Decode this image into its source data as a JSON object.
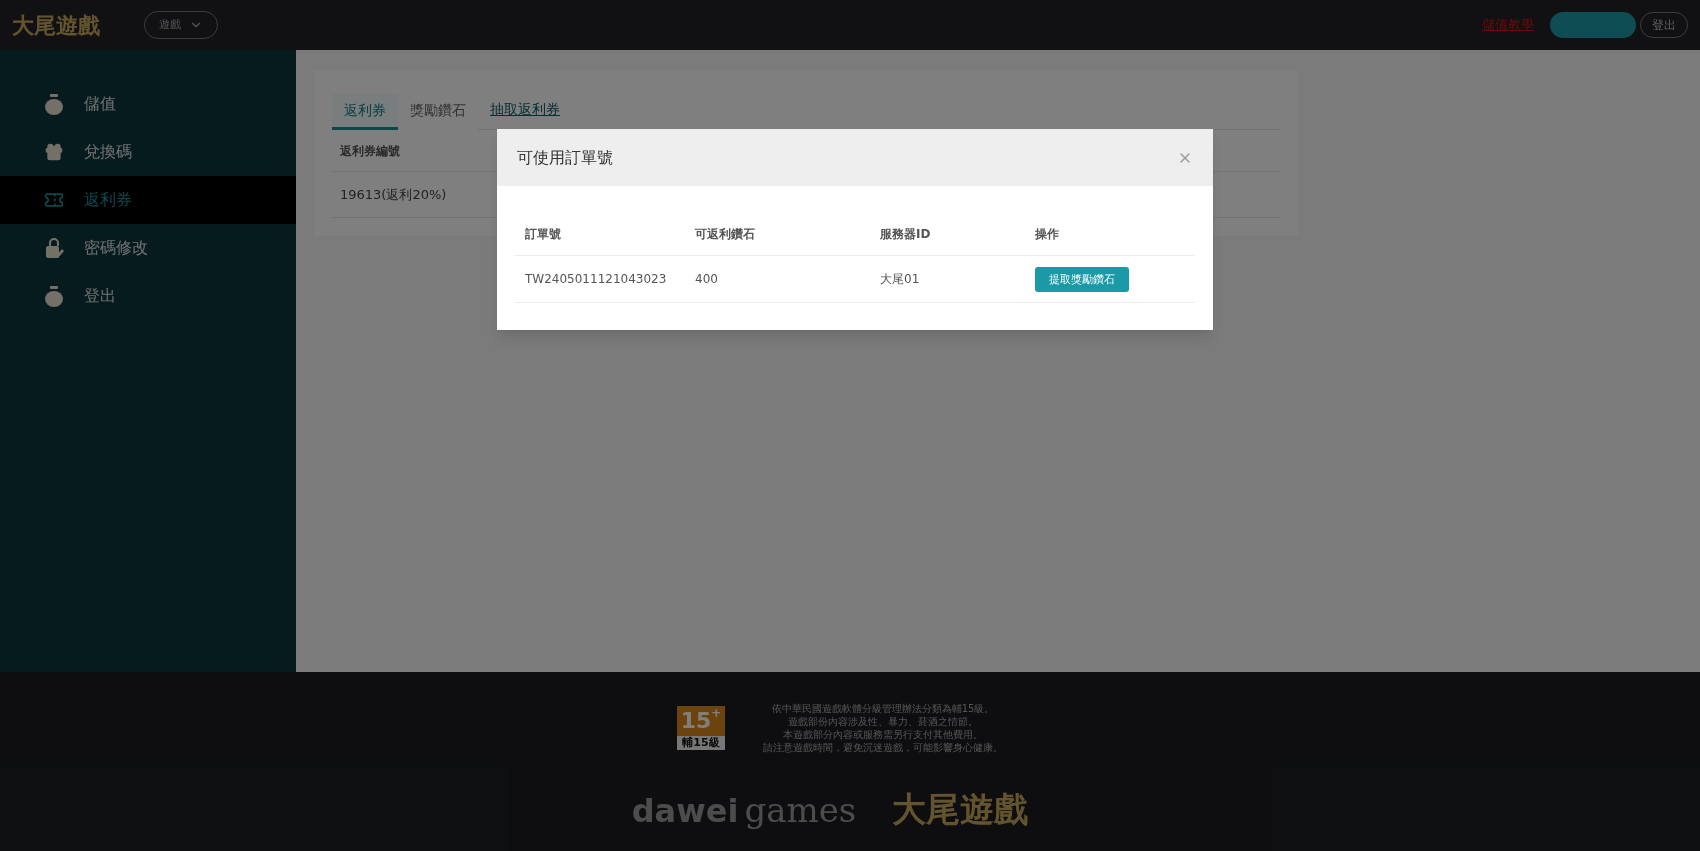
{
  "header": {
    "logo": "大尾遊戲",
    "game_select": {
      "value": "遊戲"
    },
    "tutorial_link": "儲值教學",
    "logout_button": "登出"
  },
  "sidebar": {
    "items": [
      {
        "label": "儲值",
        "selected": false
      },
      {
        "label": "兌換碼",
        "selected": false
      },
      {
        "label": "返利券",
        "selected": true
      },
      {
        "label": "密碼修改",
        "selected": false
      },
      {
        "label": "登出",
        "selected": false
      }
    ]
  },
  "tabs": [
    {
      "label": "返利券",
      "selected": true
    },
    {
      "label": "獎勵鑽石",
      "selected": false
    }
  ],
  "draw_link": "抽取返利券",
  "table": {
    "columns": [
      "返利券編號"
    ],
    "rows": [
      [
        "19613(返利20%)"
      ]
    ]
  },
  "dialog": {
    "title": "可使用訂單號",
    "columns": [
      "訂單號",
      "可返利鑽石",
      "服務器ID",
      "操作"
    ],
    "rows": [
      {
        "order": "TW2405011121043023",
        "diamonds": "400",
        "server": "大尾01",
        "action": "提取獎勵鑽石"
      }
    ]
  },
  "footer": {
    "rating": {
      "number": "15",
      "plus": "+",
      "label": "輔15級"
    },
    "notice": [
      "依中華民國遊戲軟體分級管理辦法分類為輔15級。",
      "遊戲部份內容涉及性、暴力、菸酒之情節。",
      "本遊戲部分內容或服務需另行支付其他費用。",
      "請注意遊戲時間，避免沉迷遊戲，可能影響身心健康。"
    ],
    "brand_left": "dawei",
    "brand_right": "games",
    "brand_logo": "大尾遊戲"
  }
}
